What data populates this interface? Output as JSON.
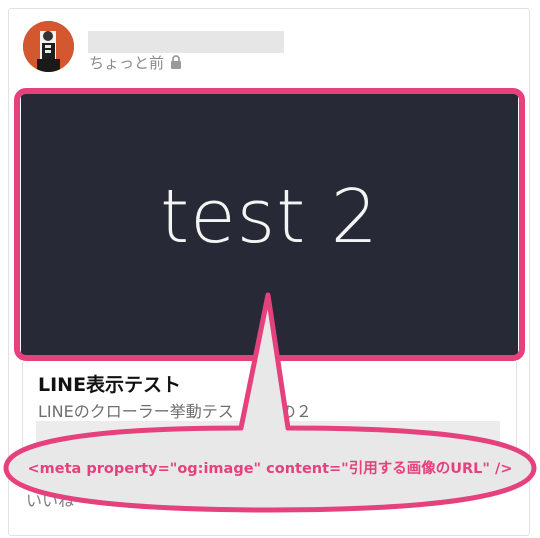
{
  "post": {
    "timestamp": "ちょっと前",
    "privacy_icon": "lock-icon",
    "avatar_icon": "avatar-image"
  },
  "link_preview": {
    "image_text": "test 2",
    "image_bg": "#272a36",
    "title": "LINE表示テスト",
    "description": "LINEのクローラー挙動テス",
    "description_end": "の２"
  },
  "actions": {
    "like_label": "いいね"
  },
  "annotation": {
    "text": "<meta property=\"og:image\" content=\"引用する画像のURL\" />",
    "color": "#e4417d",
    "fill": "#e8e8e8"
  }
}
